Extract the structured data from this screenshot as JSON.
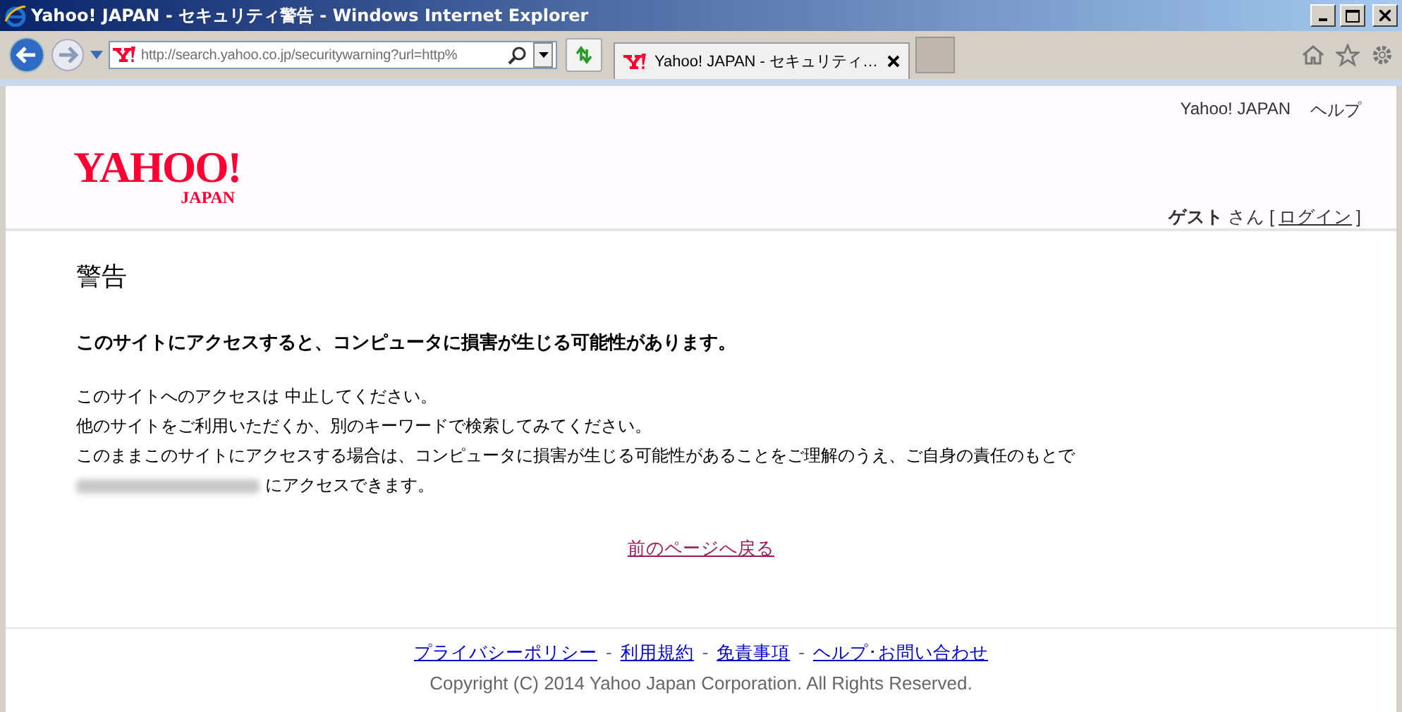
{
  "window": {
    "title": "Yahoo! JAPAN - セキュリティ警告 - Windows Internet Explorer"
  },
  "toolbar": {
    "address": "http://search.yahoo.co.jp/securitywarning?url=http%",
    "tabs": [
      {
        "label": "Yahoo!  JAPAN - セキュリティ…",
        "selected": true
      }
    ]
  },
  "header": {
    "logo": {
      "main": "YAHOO!",
      "sub": "JAPAN"
    },
    "links": [
      "Yahoo! JAPAN",
      "ヘルプ"
    ],
    "user": {
      "name": "ゲスト",
      "suffix": "さん [",
      "login": "ログイン",
      "close": "]"
    }
  },
  "content": {
    "title": "警告",
    "heading": "このサイトにアクセスすると、コンピュータに損害が生じる可能性があります。",
    "lines": [
      "このサイトへのアクセスは 中止してください。",
      "他のサイトをご利用いただくか、別のキーワードで検索してみてください。",
      "このままこのサイトにアクセスする場合は、コンピュータに損害が生じる可能性があることをご理解のうえ、ご自身の責任のもとで"
    ],
    "last_line": "にアクセスできます。",
    "back_link": "前のページへ戻る"
  },
  "footer": {
    "links": [
      "プライバシーポリシー",
      "利用規約",
      "免責事項",
      "ヘルプ･お問い合わせ"
    ],
    "separator": "-",
    "copyright": "Copyright (C) 2014 Yahoo Japan Corporation. All Rights Reserved."
  }
}
